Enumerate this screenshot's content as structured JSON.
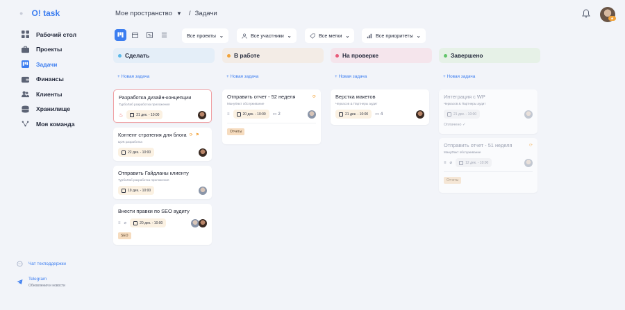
{
  "app": {
    "logo": "O! task"
  },
  "sidebar": {
    "items": [
      {
        "label": "Рабочий стол",
        "icon": "grid-icon"
      },
      {
        "label": "Проекты",
        "icon": "briefcase-icon"
      },
      {
        "label": "Задачи",
        "icon": "kanban-icon",
        "active": true
      },
      {
        "label": "Финансы",
        "icon": "wallet-icon"
      },
      {
        "label": "Клиенты",
        "icon": "users-icon"
      },
      {
        "label": "Хранилище",
        "icon": "database-icon"
      },
      {
        "label": "Моя команда",
        "icon": "team-icon"
      }
    ],
    "support": "Чат техподдержки",
    "telegram": {
      "title": "Telegram",
      "subtitle": "Обновления и новости"
    }
  },
  "header": {
    "workspace": "Мое пространство",
    "separator": "/",
    "page": "Задачи"
  },
  "toolbar": {
    "filters": [
      "Все проекты",
      "Все участники",
      "Все метки",
      "Все приоритеты"
    ]
  },
  "board": {
    "add_task_label": "+ Новая задача",
    "columns": [
      {
        "title": "Сделать",
        "color": "#5bb8e8",
        "bg": "#e4eef8"
      },
      {
        "title": "В работе",
        "color": "#f2a33a",
        "bg": "#f3ece6"
      },
      {
        "title": "На проверке",
        "color": "#e85a7a",
        "bg": "#f5e5ec"
      },
      {
        "title": "Завершено",
        "color": "#62c46a",
        "bg": "#e6f1e7"
      }
    ],
    "cards": {
      "todo": [
        {
          "title": "Разработка дизайн-концепции",
          "sub": "ТурбоЛаб разработка приложения",
          "date": "21 дек. - 10:00"
        },
        {
          "title": "Контент стратегия для блога",
          "sub": "ЦОК разработка",
          "date": "22 дек. - 10:00"
        },
        {
          "title": "Отправить Гайдланы клиенту",
          "sub": "ТурбоЛаб разработка приложения",
          "date": "19 дек. - 10:00"
        },
        {
          "title": "Внести правки по SEO аудиту",
          "sub": "",
          "date": "20 дек. - 10:00",
          "tag": "SEO"
        }
      ],
      "in_progress": [
        {
          "title": "Отправить отчет - 52 неделя",
          "sub": "МануФакт обслуживание",
          "date": "20 дек. - 10:00",
          "comments": "2",
          "tag": "Отчеты"
        }
      ],
      "review": [
        {
          "title": "Верстка макетов",
          "sub": "Черкасов & Партнеры аудит",
          "date": "21 дек. - 10:00",
          "comments": "4"
        }
      ],
      "done": [
        {
          "title": "Интеграция с WP",
          "sub": "Черкасов & Партнеры аудит",
          "date": "21 дек. - 10:00",
          "note": "Оплачено ✓"
        },
        {
          "title": "Отправить отчет - 51 неделя",
          "sub": "МануФакт обслуживание",
          "date": "12 дек. - 10:00",
          "tag": "Отчеты"
        }
      ]
    }
  }
}
